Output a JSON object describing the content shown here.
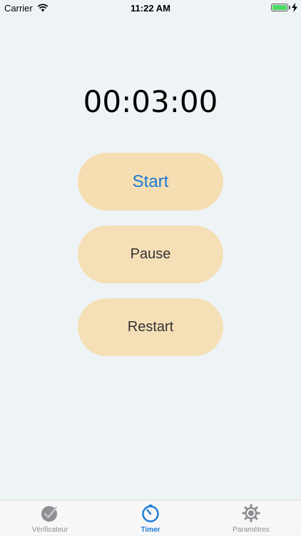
{
  "status_bar": {
    "carrier": "Carrier",
    "time": "11:22 AM",
    "battery_color": "#4cd964"
  },
  "timer": {
    "display": "00:03:00"
  },
  "buttons": {
    "start": "Start",
    "pause": "Pause",
    "restart": "Restart"
  },
  "tab_bar": {
    "items": [
      {
        "label": "Vérificateur",
        "icon": "checkmark-icon",
        "selected": false
      },
      {
        "label": "Timer",
        "icon": "timer-icon",
        "selected": true
      },
      {
        "label": "Paramètres",
        "icon": "gear-icon",
        "selected": false
      }
    ]
  },
  "colors": {
    "background": "#eef4f6",
    "button_fill": "#f5dfb7",
    "accent": "#1a7ad6"
  }
}
